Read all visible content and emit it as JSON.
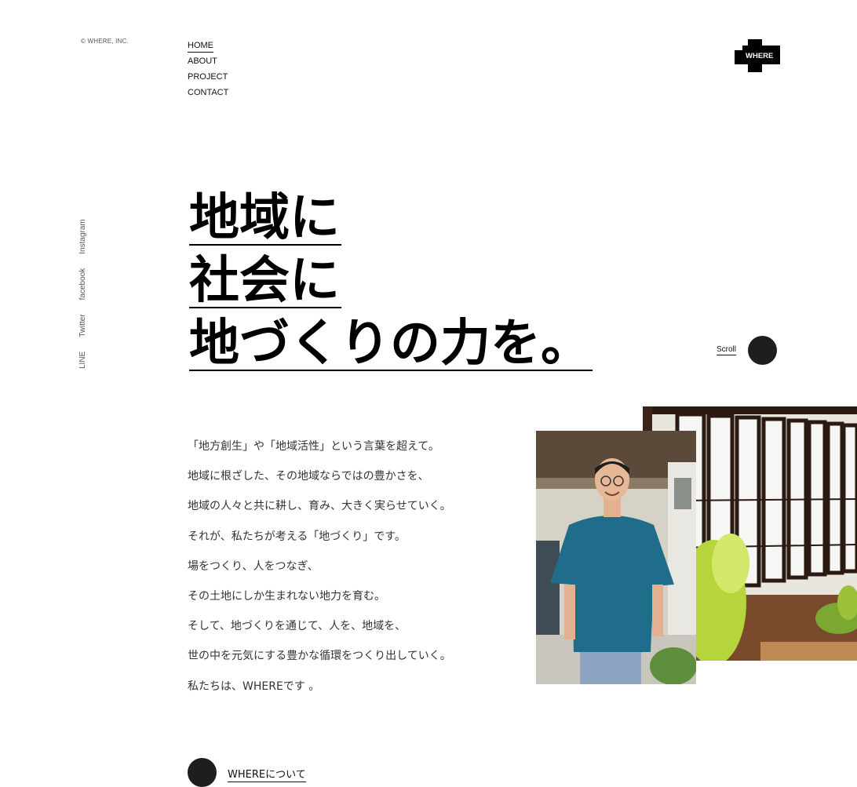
{
  "copyright": "© WHERE, INC.",
  "nav": {
    "items": [
      {
        "label": "HOME",
        "active": true
      },
      {
        "label": "ABOUT"
      },
      {
        "label": "PROJECT"
      },
      {
        "label": "CONTACT"
      }
    ]
  },
  "logo": {
    "text": "WHERE"
  },
  "social": {
    "instagram": "Instagram",
    "facebook": "facebook",
    "twitter": "Twitter",
    "line": "LINE"
  },
  "hero": {
    "lines": [
      "地域に",
      "社会に",
      "地づくりの力を。"
    ]
  },
  "scroll": {
    "label": "Scroll"
  },
  "intro": {
    "lines": [
      "「地方創生」や「地域活性」という言葉を超えて。",
      "地域に根ざした、その地域ならではの豊かさを、",
      "地域の人々と共に耕し、育み、大きく実らせていく。",
      "それが、私たちが考える「地づくり」です。",
      "場をつくり、人をつなぎ、",
      "その土地にしか生まれない地力を育む。",
      "そして、地づくりを通じて、人を、地域を、",
      "世の中を元気にする豊かな循環をつくり出していく。",
      "私たちは、WHEREです 。"
    ]
  },
  "about_link": {
    "label": "WHEREについて"
  },
  "colors": {
    "text": "#111111",
    "dot": "#1e1e1e",
    "background": "#ffffff"
  }
}
